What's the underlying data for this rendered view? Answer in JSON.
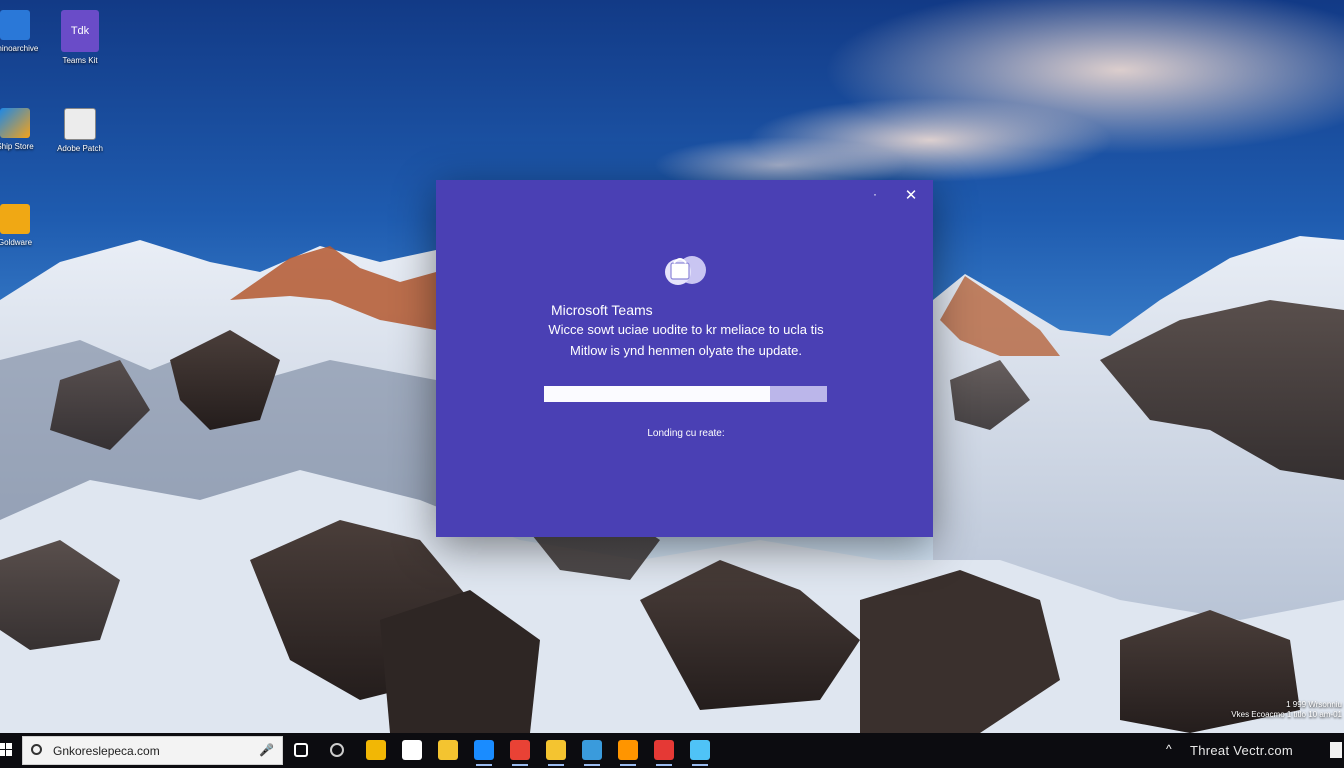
{
  "desktop": {
    "icons": [
      {
        "label": "Rhinoarchive",
        "color": "#2a78d8"
      },
      {
        "label": "Teams Kit",
        "glyph_text": "Tdk",
        "color": "#6a4cc8"
      },
      {
        "label": "Ship Store",
        "color": "#1e88e5"
      },
      {
        "label": "Adobe Patch",
        "color": "#e8e8e8"
      },
      {
        "label": "Goldware",
        "color": "#f0a814"
      }
    ]
  },
  "dialog": {
    "minimize_glyph": "·",
    "close_glyph": "✕",
    "title": "Microsoft Teams",
    "message_line1": "Wicce sowt uciae uodite to kr meliace to ucla tis",
    "message_line2": "Mitlow is ynd henmen olyate the update.",
    "progress_fraction": 0.8,
    "status": "Londing cu reate:"
  },
  "taskbar": {
    "search_text": "Gnkoreslepeca.com",
    "mic_glyph": "🎤",
    "pinned_icons": [
      {
        "name": "task-view-icon",
        "color": "#ffffff"
      },
      {
        "name": "cortana-icon",
        "color": "#cccccc"
      },
      {
        "name": "file-explorer-icon",
        "color": "#f2b705"
      },
      {
        "name": "store-icon",
        "color": "#ffffff"
      },
      {
        "name": "folder-icon",
        "color": "#f4c430"
      },
      {
        "name": "edge-icon",
        "color": "#1a8cff"
      },
      {
        "name": "chrome-icon",
        "color": "#e94235"
      },
      {
        "name": "explorer-icon",
        "color": "#f4c430"
      },
      {
        "name": "teams-icon",
        "color": "#3a9bdc"
      },
      {
        "name": "firefox-icon",
        "color": "#ff9500"
      },
      {
        "name": "security-icon",
        "color": "#e53935"
      },
      {
        "name": "app-icon",
        "color": "#4fc3f7"
      }
    ],
    "tray_chevron": "^",
    "tray_text": "Threat Vectr.com"
  },
  "corner_note": {
    "line1": "1 999 Wrsonniu",
    "line2": "Vkes Ecoacmo 1 titlo 10 am-01"
  }
}
